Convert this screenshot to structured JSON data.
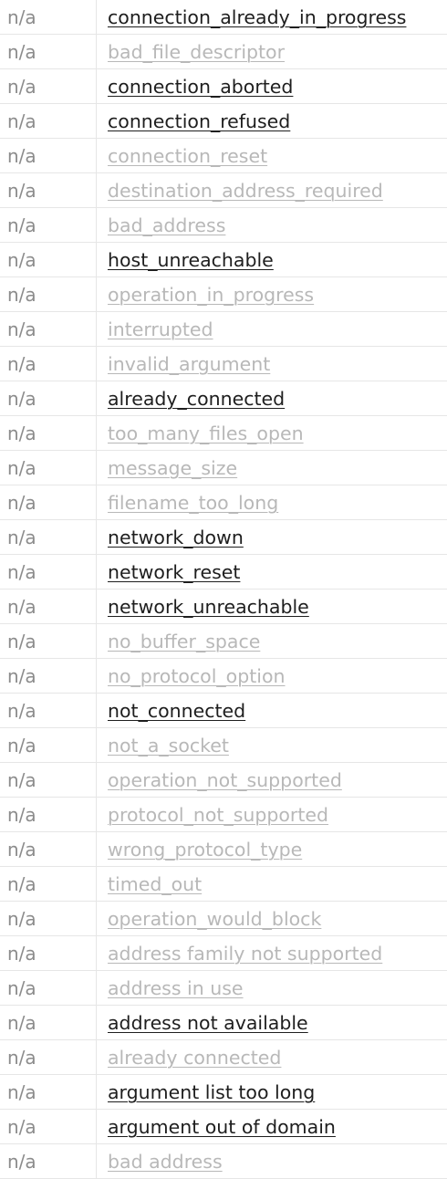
{
  "rows": [
    {
      "code": "n/a",
      "name": "connection_already_in_progress",
      "active": true
    },
    {
      "code": "n/a",
      "name": "bad_file_descriptor",
      "active": false
    },
    {
      "code": "n/a",
      "name": "connection_aborted",
      "active": true
    },
    {
      "code": "n/a",
      "name": "connection_refused",
      "active": true
    },
    {
      "code": "n/a",
      "name": "connection_reset",
      "active": false
    },
    {
      "code": "n/a",
      "name": "destination_address_required",
      "active": false
    },
    {
      "code": "n/a",
      "name": "bad_address",
      "active": false
    },
    {
      "code": "n/a",
      "name": "host_unreachable",
      "active": true
    },
    {
      "code": "n/a",
      "name": "operation_in_progress",
      "active": false
    },
    {
      "code": "n/a",
      "name": "interrupted",
      "active": false
    },
    {
      "code": "n/a",
      "name": "invalid_argument",
      "active": false
    },
    {
      "code": "n/a",
      "name": "already_connected",
      "active": true
    },
    {
      "code": "n/a",
      "name": "too_many_files_open",
      "active": false
    },
    {
      "code": "n/a",
      "name": "message_size",
      "active": false
    },
    {
      "code": "n/a",
      "name": "filename_too_long",
      "active": false
    },
    {
      "code": "n/a",
      "name": "network_down",
      "active": true
    },
    {
      "code": "n/a",
      "name": "network_reset",
      "active": true
    },
    {
      "code": "n/a",
      "name": "network_unreachable",
      "active": true
    },
    {
      "code": "n/a",
      "name": "no_buffer_space",
      "active": false
    },
    {
      "code": "n/a",
      "name": "no_protocol_option",
      "active": false
    },
    {
      "code": "n/a",
      "name": "not_connected",
      "active": true
    },
    {
      "code": "n/a",
      "name": "not_a_socket",
      "active": false
    },
    {
      "code": "n/a",
      "name": "operation_not_supported",
      "active": false
    },
    {
      "code": "n/a",
      "name": "protocol_not_supported",
      "active": false
    },
    {
      "code": "n/a",
      "name": "wrong_protocol_type",
      "active": false
    },
    {
      "code": "n/a",
      "name": "timed_out",
      "active": false
    },
    {
      "code": "n/a",
      "name": "operation_would_block",
      "active": false
    },
    {
      "code": "n/a",
      "name": "address family not supported",
      "active": false
    },
    {
      "code": "n/a",
      "name": "address in use",
      "active": false
    },
    {
      "code": "n/a",
      "name": "address not available",
      "active": true
    },
    {
      "code": "n/a",
      "name": "already connected",
      "active": false
    },
    {
      "code": "n/a",
      "name": "argument list too long",
      "active": true
    },
    {
      "code": "n/a",
      "name": "argument out of domain",
      "active": true
    },
    {
      "code": "n/a",
      "name": "bad address",
      "active": false
    }
  ]
}
